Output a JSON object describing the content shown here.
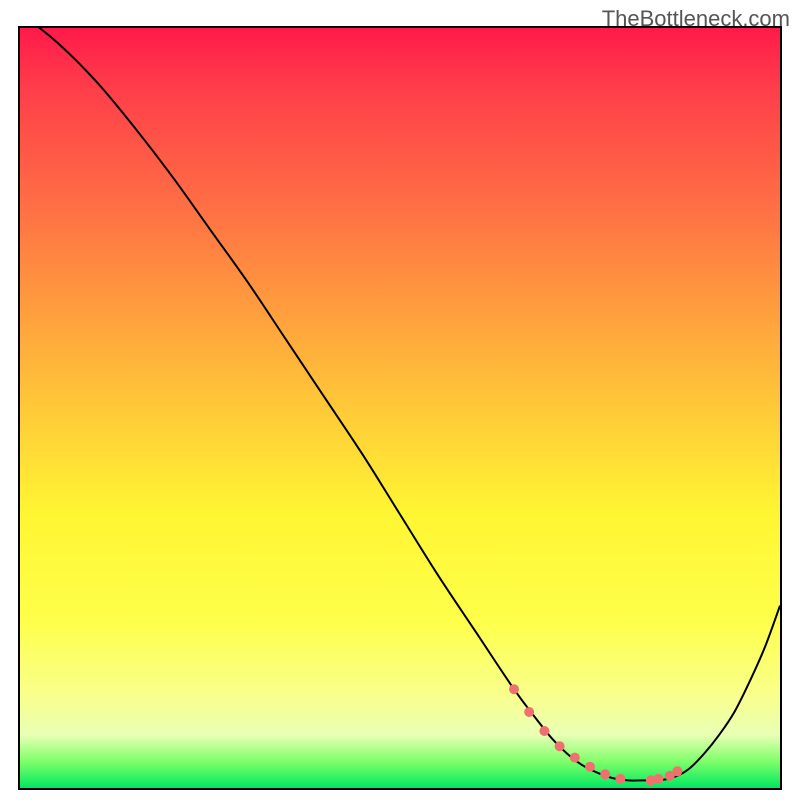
{
  "watermark": "TheBottleneck.com",
  "chart_data": {
    "type": "line",
    "title": "",
    "xlabel": "",
    "ylabel": "",
    "xlim": [
      0,
      100
    ],
    "ylim": [
      0,
      100
    ],
    "x": [
      0,
      5,
      10,
      15,
      20,
      25,
      30,
      35,
      40,
      45,
      50,
      55,
      60,
      65,
      68,
      70,
      72,
      74,
      76,
      78,
      80,
      82,
      84,
      86,
      88,
      90,
      92,
      94,
      96,
      98,
      100
    ],
    "values": [
      102,
      98,
      93,
      87,
      80.5,
      73.5,
      66.5,
      59,
      51.5,
      44,
      36,
      28,
      20.5,
      13,
      9,
      6.5,
      4.5,
      3,
      2,
      1.3,
      1,
      1,
      1,
      1.4,
      2.5,
      4.5,
      7,
      10,
      14,
      18.5,
      24
    ],
    "markers": {
      "x": [
        65,
        67,
        69,
        71,
        73,
        75,
        77,
        79,
        83,
        84,
        85.5,
        86.5
      ],
      "values": [
        13,
        10,
        7.5,
        5.5,
        4,
        2.8,
        1.8,
        1.2,
        1,
        1.2,
        1.6,
        2.2
      ]
    },
    "gradient_stops": [
      {
        "pos": 0,
        "color": "#ff1a4a"
      },
      {
        "pos": 22,
        "color": "#ff6a45"
      },
      {
        "pos": 50,
        "color": "#ffc938"
      },
      {
        "pos": 78,
        "color": "#feff4a"
      },
      {
        "pos": 96.5,
        "color": "#7fff6a"
      },
      {
        "pos": 100,
        "color": "#00e860"
      }
    ]
  }
}
